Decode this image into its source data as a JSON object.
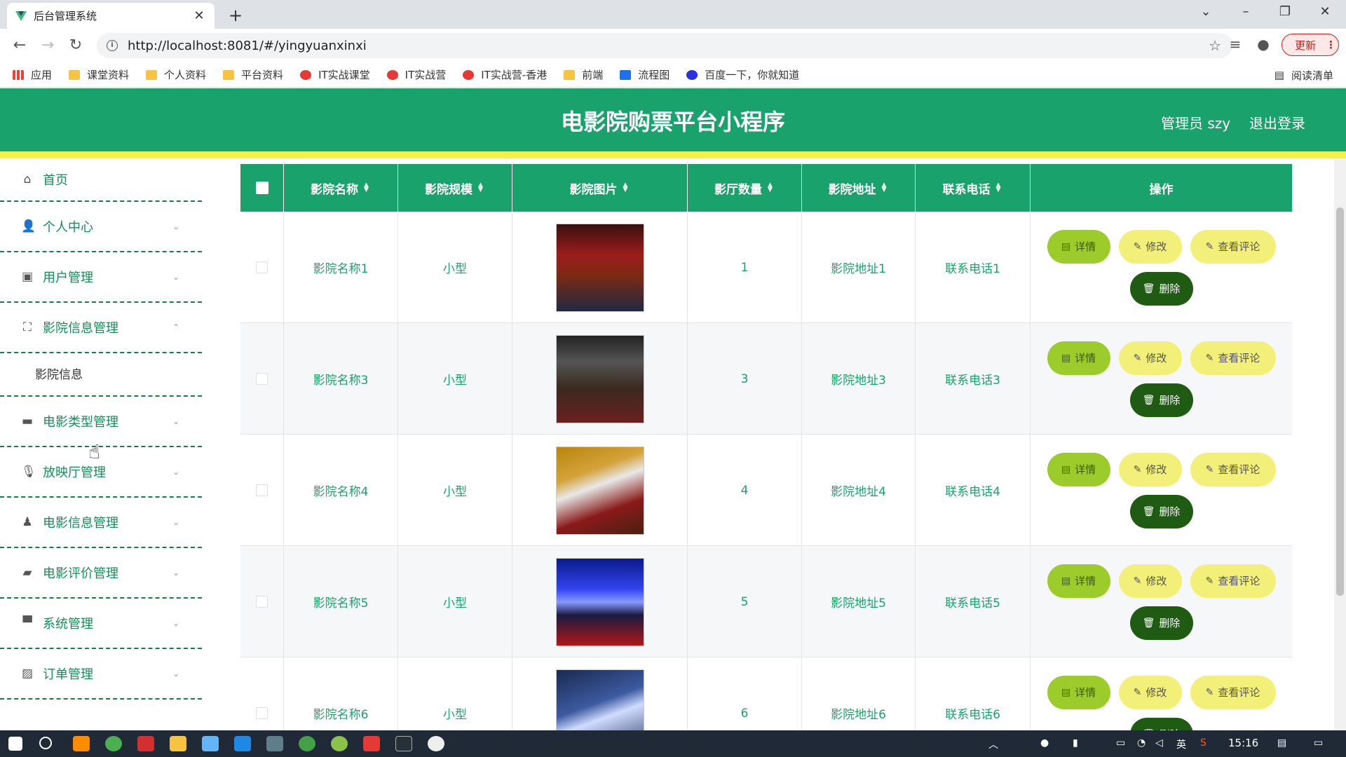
{
  "browser": {
    "tab_title": "后台管理系统",
    "tab_close": "✕",
    "new_tab": "+",
    "url": "http://localhost:8081/#/yingyuanxinxi",
    "update_label": "更新",
    "bookmarks": [
      "应用",
      "课堂资料",
      "个人资料",
      "平台资料",
      "IT实战课堂",
      "IT实战营",
      "IT实战营-香港",
      "前端",
      "流程图",
      "百度一下，你就知道"
    ],
    "bookmark_icons": [
      "apps-icon",
      "folder-icon",
      "folder-icon",
      "folder-icon",
      "it-icon",
      "it-icon",
      "it-icon",
      "folder-icon",
      "on-icon",
      "baidu-icon"
    ],
    "reading_list": "阅读清单"
  },
  "header": {
    "title": "电影院购票平台小程序",
    "admin": "管理员 szy",
    "logout": "退出登录",
    "brand_color": "#1aa26d",
    "accent_color": "#f2f24a"
  },
  "sidebar": {
    "items": [
      {
        "label": "首页",
        "icon": "home-icon",
        "expandable": false
      },
      {
        "label": "个人中心",
        "icon": "user-icon",
        "expandable": true
      },
      {
        "label": "用户管理",
        "icon": "user-manage-icon",
        "expandable": true
      },
      {
        "label": "影院信息管理",
        "icon": "cinema-icon",
        "expandable": true,
        "expanded": true
      },
      {
        "label": "电影类型管理",
        "icon": "briefcase-icon",
        "expandable": true
      },
      {
        "label": "放映厅管理",
        "icon": "mic-icon",
        "expandable": true
      },
      {
        "label": "电影信息管理",
        "icon": "stamp-icon",
        "expandable": true
      },
      {
        "label": "电影评价管理",
        "icon": "wallet-icon",
        "expandable": true
      },
      {
        "label": "系统管理",
        "icon": "settings-icon",
        "expandable": true
      },
      {
        "label": "订单管理",
        "icon": "chart-icon",
        "expandable": true
      }
    ],
    "submenu": "影院信息"
  },
  "table": {
    "headers": [
      "影院名称",
      "影院规模",
      "影院图片",
      "影厅数量",
      "影院地址",
      "联系电话",
      "操作"
    ],
    "rows": [
      {
        "name": "影院名称1",
        "scale": "小型",
        "halls": "1",
        "address": "影院地址1",
        "phone": "联系电话1"
      },
      {
        "name": "影院名称3",
        "scale": "小型",
        "halls": "3",
        "address": "影院地址3",
        "phone": "联系电话3"
      },
      {
        "name": "影院名称4",
        "scale": "小型",
        "halls": "4",
        "address": "影院地址4",
        "phone": "联系电话4"
      },
      {
        "name": "影院名称5",
        "scale": "小型",
        "halls": "5",
        "address": "影院地址5",
        "phone": "联系电话5"
      },
      {
        "name": "影院名称6",
        "scale": "小型",
        "halls": "6",
        "address": "影院地址6",
        "phone": "联系电话6"
      }
    ],
    "actions": {
      "detail": "详情",
      "edit": "修改",
      "review": "查看评论",
      "delete": "删除"
    }
  },
  "taskbar": {
    "time": "15:16",
    "ime": "英"
  }
}
